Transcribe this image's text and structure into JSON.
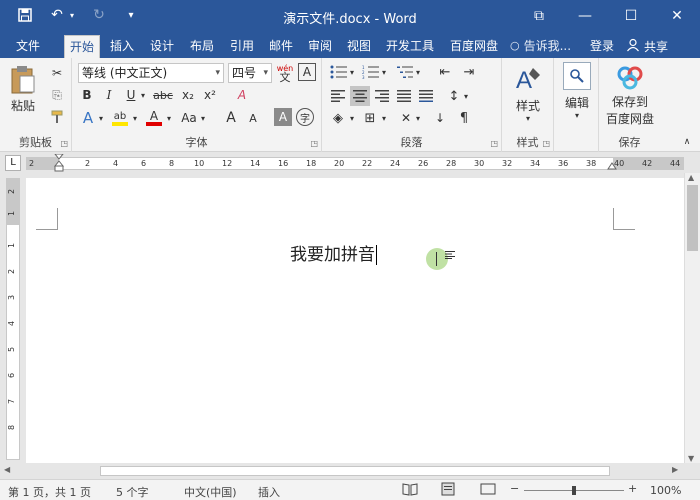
{
  "window": {
    "title": "演示文件.docx - Word",
    "restore_icon": "⧉",
    "minimize_icon": "—",
    "maximize_icon": "☐",
    "close_icon": "✕"
  },
  "quick_access": {
    "save_icon": "💾",
    "undo_icon": "↶",
    "redo_icon": "↻",
    "customize_icon": "▾"
  },
  "tabs": [
    {
      "label": "文件"
    },
    {
      "label": "开始"
    },
    {
      "label": "插入"
    },
    {
      "label": "设计"
    },
    {
      "label": "布局"
    },
    {
      "label": "引用"
    },
    {
      "label": "邮件"
    },
    {
      "label": "审阅"
    },
    {
      "label": "视图"
    },
    {
      "label": "开发工具"
    },
    {
      "label": "百度网盘"
    }
  ],
  "tell_me": {
    "icon": "💡",
    "text": "告诉我..."
  },
  "login_label": "登录",
  "share": {
    "icon": "👤",
    "label": "共享"
  },
  "ribbon": {
    "clipboard": {
      "label": "剪贴板",
      "paste_label": "粘贴",
      "cut_icon": "✂",
      "copy_icon": "⎘",
      "format_painter_icon": "🖌"
    },
    "font": {
      "label": "字体",
      "font_name": "等线 (中文正文)",
      "font_size": "四号",
      "wen_icon": "wén",
      "border_char_icon": "A",
      "bold": "B",
      "italic": "I",
      "underline": "U",
      "strikethrough": "abc",
      "subscript": "x₂",
      "superscript": "x²",
      "clear_format_icon": "A",
      "text_effect": "A",
      "highlight": "ab",
      "font_color": "A",
      "change_case": "Aa",
      "grow_font": "A",
      "shrink_font": "A",
      "char_shading": "A",
      "enclose_char": "字"
    },
    "paragraph": {
      "label": "段落",
      "bullets_icon": "☰",
      "numbering_icon": "☷",
      "multilevel_icon": "☰",
      "decrease_indent_icon": "⇤",
      "increase_indent_icon": "⇥",
      "align_left_icon": "☰",
      "align_center_icon": "☰",
      "align_right_icon": "☰",
      "justify_icon": "☰",
      "distributed_icon": "☰",
      "line_spacing_icon": "↕",
      "shading_icon": "◈",
      "borders_icon": "⊞",
      "chinese_layout_icon": "✕",
      "sort_icon": "↓",
      "show_marks_icon": "¶"
    },
    "styles": {
      "label": "样式",
      "button_label": "样式",
      "icon": "A"
    },
    "editing": {
      "label": "编辑",
      "icon": "🔍"
    },
    "save": {
      "label": "保存",
      "button_line1": "保存到",
      "button_line2": "百度网盘"
    }
  },
  "ruler": {
    "ticks": [
      "2",
      "2",
      "4",
      "6",
      "8",
      "10",
      "12",
      "14",
      "16",
      "18",
      "20",
      "22",
      "24",
      "26",
      "28",
      "30",
      "32",
      "34",
      "36",
      "38",
      "40",
      "42",
      "44"
    ],
    "corner_icon": "L"
  },
  "vruler": {
    "ticks": [
      "2",
      "1",
      "1",
      "2",
      "3",
      "4",
      "5",
      "6",
      "7",
      "8"
    ]
  },
  "document": {
    "text": "我要加拼音"
  },
  "status": {
    "page": "第 1 页，共 1 页",
    "words": "5 个字",
    "language": "中文(中国)",
    "mode": "插入",
    "read_mode_icon": "📖",
    "print_layout_icon": "▤",
    "web_layout_icon": "▭",
    "zoom_out": "−",
    "zoom_in": "+",
    "zoom": "100%"
  },
  "colors": {
    "accent": "#2b579a",
    "ribbon_bg": "#f3f3f3",
    "highlight_yellow": "#ffe600",
    "font_red": "#e00000"
  }
}
